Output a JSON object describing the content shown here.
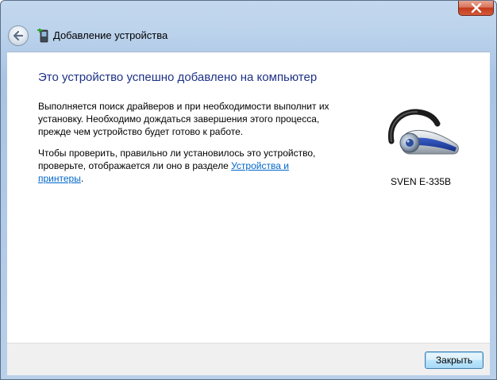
{
  "window": {
    "title": "Добавление устройства",
    "close_glyph": "✕"
  },
  "content": {
    "heading": "Это устройство успешно добавлено на компьютер",
    "paragraph1": "Выполняется поиск драйверов и при необходимости выполнит их установку. Необходимо дождаться завершения этого процесса, прежде чем устройство будет готово к работе.",
    "paragraph2_prefix": "Чтобы проверить, правильно ли установилось это устройство, проверьте, отображается ли оно в разделе ",
    "paragraph2_link": "Устройства и принтеры",
    "paragraph2_suffix": "."
  },
  "device": {
    "name": "SVEN E-335B",
    "icon": "bluetooth-headset-icon"
  },
  "footer": {
    "close_label": "Закрыть"
  },
  "colors": {
    "heading": "#1e3287",
    "link": "#0066cc",
    "close_button": "#c4391a"
  }
}
